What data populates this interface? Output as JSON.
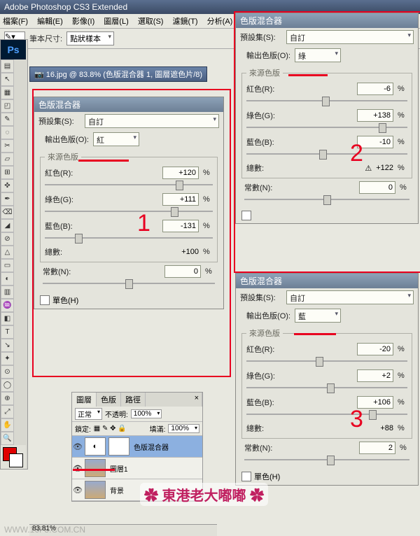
{
  "app": {
    "title": "Adobe Photoshop CS3 Extended"
  },
  "menu": {
    "file": "檔案(F)",
    "edit": "編輯(E)",
    "image": "影像(I)",
    "layer": "圖層(L)",
    "select": "選取(S)",
    "filter": "濾鏡(T)",
    "analysis": "分析(A)"
  },
  "opt": {
    "label": "筆本尺寸:",
    "value": "點狀樣本"
  },
  "doc": {
    "tab": "16.jpg @ 83.8% (色版混合器 1, 圖層遮色片/8)"
  },
  "tools": [
    "▤",
    "↖",
    "▦",
    "◰",
    "✎",
    "◌",
    "✂",
    "▱",
    "⊞",
    "✜",
    "✒",
    "⌫",
    "◢",
    "⊘",
    "△",
    "▭",
    "◐",
    "▥",
    "♒",
    "◧",
    "T",
    "↘",
    "✦",
    "⊙",
    "◯",
    "⊕",
    "⤢",
    "✋",
    "🔍"
  ],
  "mixer_title": "色版混合器",
  "labels": {
    "preset": "預設集(S):",
    "output": "輸出色版(O):",
    "source": "來源色版",
    "red": "紅色(R):",
    "green": "綠色(G):",
    "blue": "藍色(B):",
    "total": "總數:",
    "constant": "常數(N):",
    "mono": "單色(H)",
    "pct": "%"
  },
  "panel1": {
    "preset": "自訂",
    "output": "紅",
    "red": "+120",
    "green": "+111",
    "blue": "-131",
    "total": "+100",
    "constant": "0"
  },
  "panel2": {
    "preset": "自訂",
    "output": "綠",
    "red": "-6",
    "green": "+138",
    "blue": "-10",
    "total": "+122",
    "total_prefix": "⚠",
    "constant": "0"
  },
  "panel3": {
    "preset": "自訂",
    "output": "藍",
    "red": "-20",
    "green": "+2",
    "blue": "+106",
    "total": "+88",
    "constant": "2"
  },
  "layers": {
    "tabs": [
      "圖層",
      "色版",
      "路徑"
    ],
    "mode": "正常",
    "opacity_label": "不透明:",
    "opacity": "100%",
    "lock_label": "鎖定:",
    "fill_label": "填滿:",
    "fill": "100%",
    "items": [
      {
        "name": "色版混合器"
      },
      {
        "name": "圖層1"
      },
      {
        "name": "背景"
      }
    ]
  },
  "status": {
    "zoom": "83.81%"
  },
  "annot": {
    "n1": "1",
    "n2": "2",
    "n3": "3",
    "sig": "✿ 東港老大嘟嘟 ✿"
  },
  "wm": "WWW.16F8.COM.CN"
}
